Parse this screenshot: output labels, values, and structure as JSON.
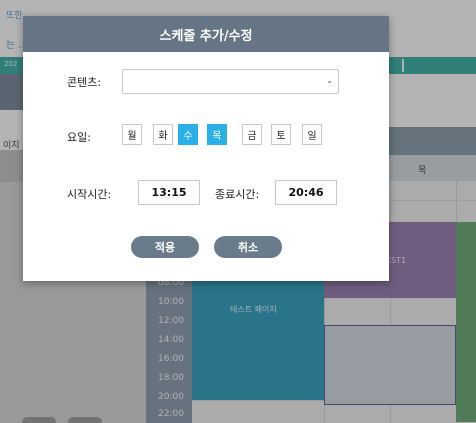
{
  "background": {
    "top_note": "또한",
    "link_text": "는 ...",
    "strip_text": "202",
    "side_label": "이지",
    "day_header": "목",
    "times": [
      "08:00",
      "10:00",
      "12:00",
      "14:00",
      "16:00",
      "18:00",
      "20:00",
      "22:00"
    ],
    "event_blue_label": "테스트 페이지",
    "event_purple_label": "EST1",
    "colors": {
      "accent_blue": "#29b0e6",
      "header_slate": "#657585",
      "event_blue": "#1f93b3",
      "event_purple": "#8a6ea1",
      "event_green": "#5f9d6a",
      "teal": "#2ca49a"
    }
  },
  "modal": {
    "title": "스케줄 추가/수정",
    "content_label": "콘텐츠:",
    "content_value": "",
    "content_arrow_icon": "chevron-down-icon",
    "days_label": "요일:",
    "days": [
      {
        "label": "월",
        "active": false
      },
      {
        "label": "화",
        "active": false
      },
      {
        "label": "수",
        "active": true
      },
      {
        "label": "목",
        "active": true
      },
      {
        "label": "금",
        "active": false
      },
      {
        "label": "토",
        "active": false
      },
      {
        "label": "일",
        "active": false
      }
    ],
    "start_label": "시작시간:",
    "start_value": "13:15",
    "end_label": "종료시간:",
    "end_value": "20:46",
    "apply_label": "적용",
    "cancel_label": "취소"
  }
}
